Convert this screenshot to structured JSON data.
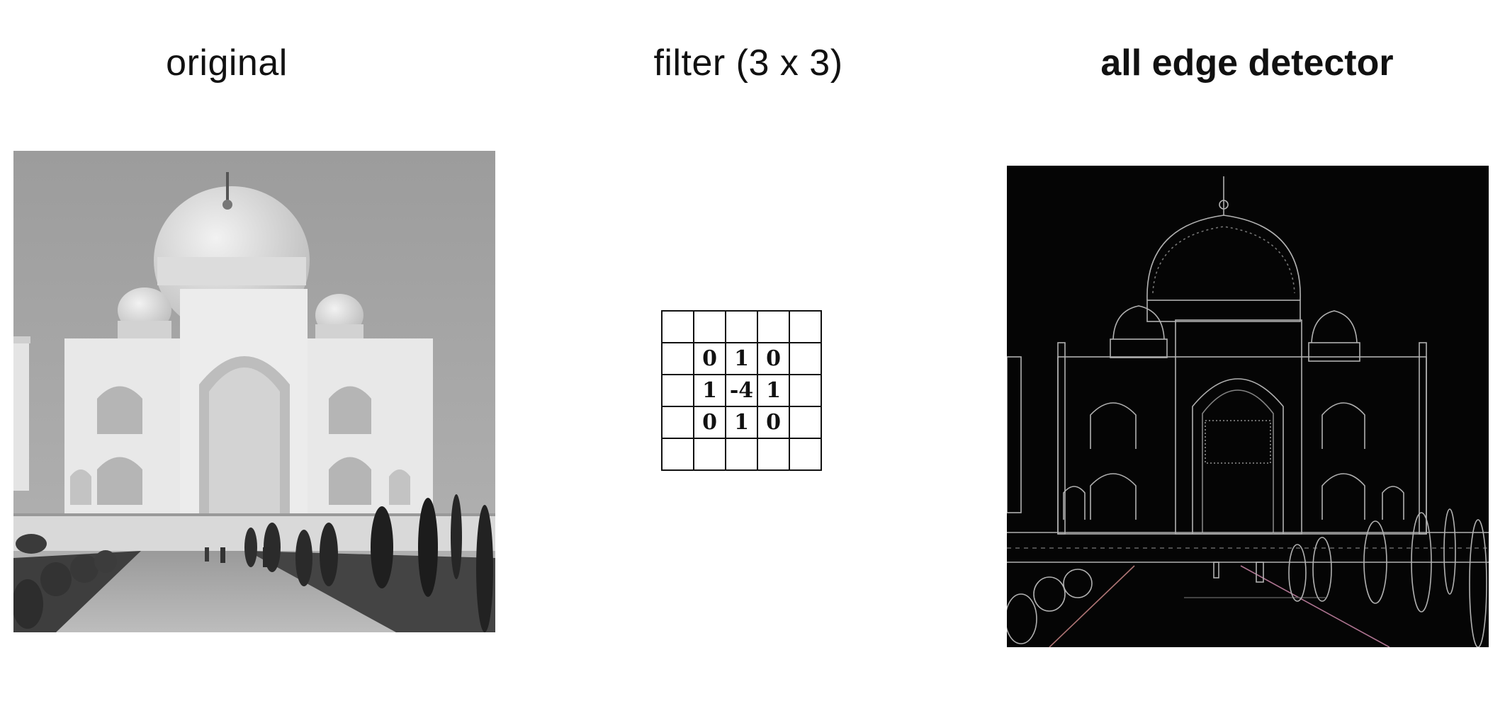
{
  "headings": {
    "original": "original",
    "filter": "filter (3 x 3)",
    "edge": "all edge detector"
  },
  "kernel": {
    "rows": [
      [
        "",
        "",
        "",
        "",
        ""
      ],
      [
        "",
        "0",
        "1",
        "0",
        ""
      ],
      [
        "",
        "1",
        "-4",
        "1",
        ""
      ],
      [
        "",
        "0",
        "1",
        "0",
        ""
      ],
      [
        "",
        "",
        "",
        "",
        ""
      ]
    ]
  },
  "colors": {
    "photo_sky": "#a8a8a8",
    "photo_marble": "#e8e8e8",
    "edge_background": "#050505",
    "edge_lines": "#d8d8d8",
    "grid_lines": "#111111"
  },
  "images": {
    "original": "taj-mahal-grayscale-photo",
    "edge": "taj-mahal-edge-detected-photo"
  }
}
